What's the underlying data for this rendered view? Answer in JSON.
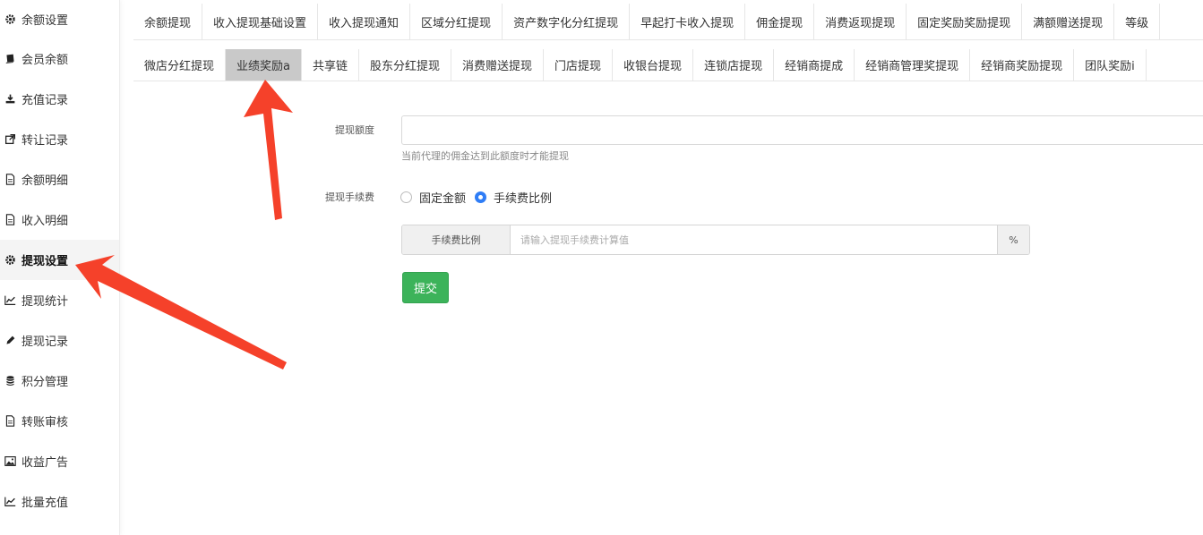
{
  "sidebar": {
    "items": [
      {
        "label": "余额设置",
        "icon": "gear-icon"
      },
      {
        "label": "会员余额",
        "icon": "book-icon"
      },
      {
        "label": "充值记录",
        "icon": "download-icon"
      },
      {
        "label": "转让记录",
        "icon": "external-link-icon"
      },
      {
        "label": "余额明细",
        "icon": "file-icon"
      },
      {
        "label": "收入明细",
        "icon": "file-icon"
      },
      {
        "label": "提现设置",
        "icon": "gear-icon"
      },
      {
        "label": "提现统计",
        "icon": "line-chart-icon"
      },
      {
        "label": "提现记录",
        "icon": "pencil-icon"
      },
      {
        "label": "积分管理",
        "icon": "database-icon"
      },
      {
        "label": "转账审核",
        "icon": "file-icon"
      },
      {
        "label": "收益广告",
        "icon": "image-icon"
      },
      {
        "label": "批量充值",
        "icon": "line-chart-icon"
      }
    ]
  },
  "tabs_row1": [
    "余额提现",
    "收入提现基础设置",
    "收入提现通知",
    "区域分红提现",
    "资产数字化分红提现",
    "早起打卡收入提现",
    "佣金提现",
    "消费返现提现",
    "固定奖励奖励提现",
    "满额赠送提现",
    "等级"
  ],
  "tabs_row2": [
    "微店分红提现",
    "业绩奖励a",
    "共享链",
    "股东分红提现",
    "消费赠送提现",
    "门店提现",
    "收银台提现",
    "连锁店提现",
    "经销商提成",
    "经销商管理奖提现",
    "经销商奖励提现",
    "团队奖励i"
  ],
  "form": {
    "amount_label": "提现额度",
    "amount_value": "",
    "amount_help": "当前代理的佣金达到此额度时才能提现",
    "fee_label": "提现手续费",
    "radio_fixed": "固定金额",
    "radio_ratio": "手续费比例",
    "fee_addon": "手续费比例",
    "fee_placeholder": "请输入提现手续费计算值",
    "fee_value": "",
    "fee_suffix": "%",
    "submit_label": "提交"
  },
  "colors": {
    "accent": "#2f7df6",
    "submit": "#3cb35a",
    "active_tab": "#c9c9c9",
    "annotation_arrow": "#f5412a"
  }
}
